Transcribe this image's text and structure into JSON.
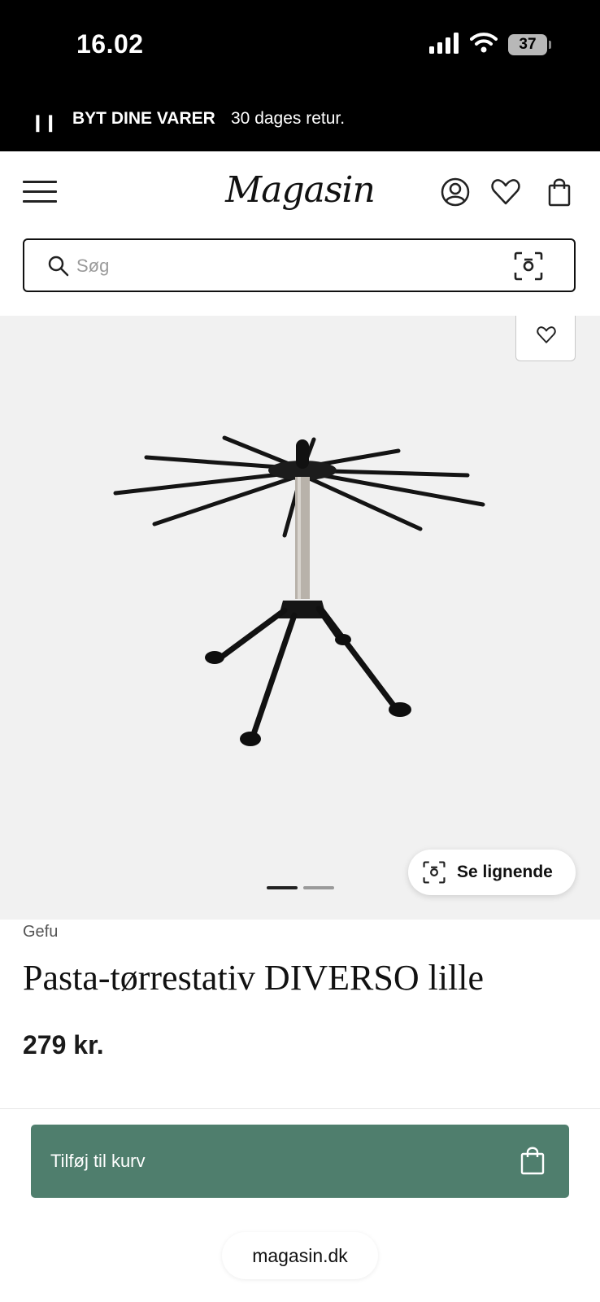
{
  "status_bar": {
    "time": "16.02",
    "battery": "37"
  },
  "promo": {
    "title": "BYT DINE VARER",
    "text": "30 dages retur."
  },
  "header": {
    "logo": "Magasin"
  },
  "search": {
    "placeholder": "Søg"
  },
  "gallery": {
    "image_count": 2,
    "active_index": 0,
    "similar_label": "Se lignende"
  },
  "product": {
    "brand": "Gefu",
    "title": "Pasta-tørrestativ DIVERSO lille",
    "price": "279 kr.",
    "add_to_cart_label": "Tilføj til kurv"
  },
  "browser": {
    "url": "magasin.dk"
  },
  "colors": {
    "accent": "#4f7e6d",
    "promo_bg": "#000000",
    "image_bg": "#f1f1f1"
  }
}
